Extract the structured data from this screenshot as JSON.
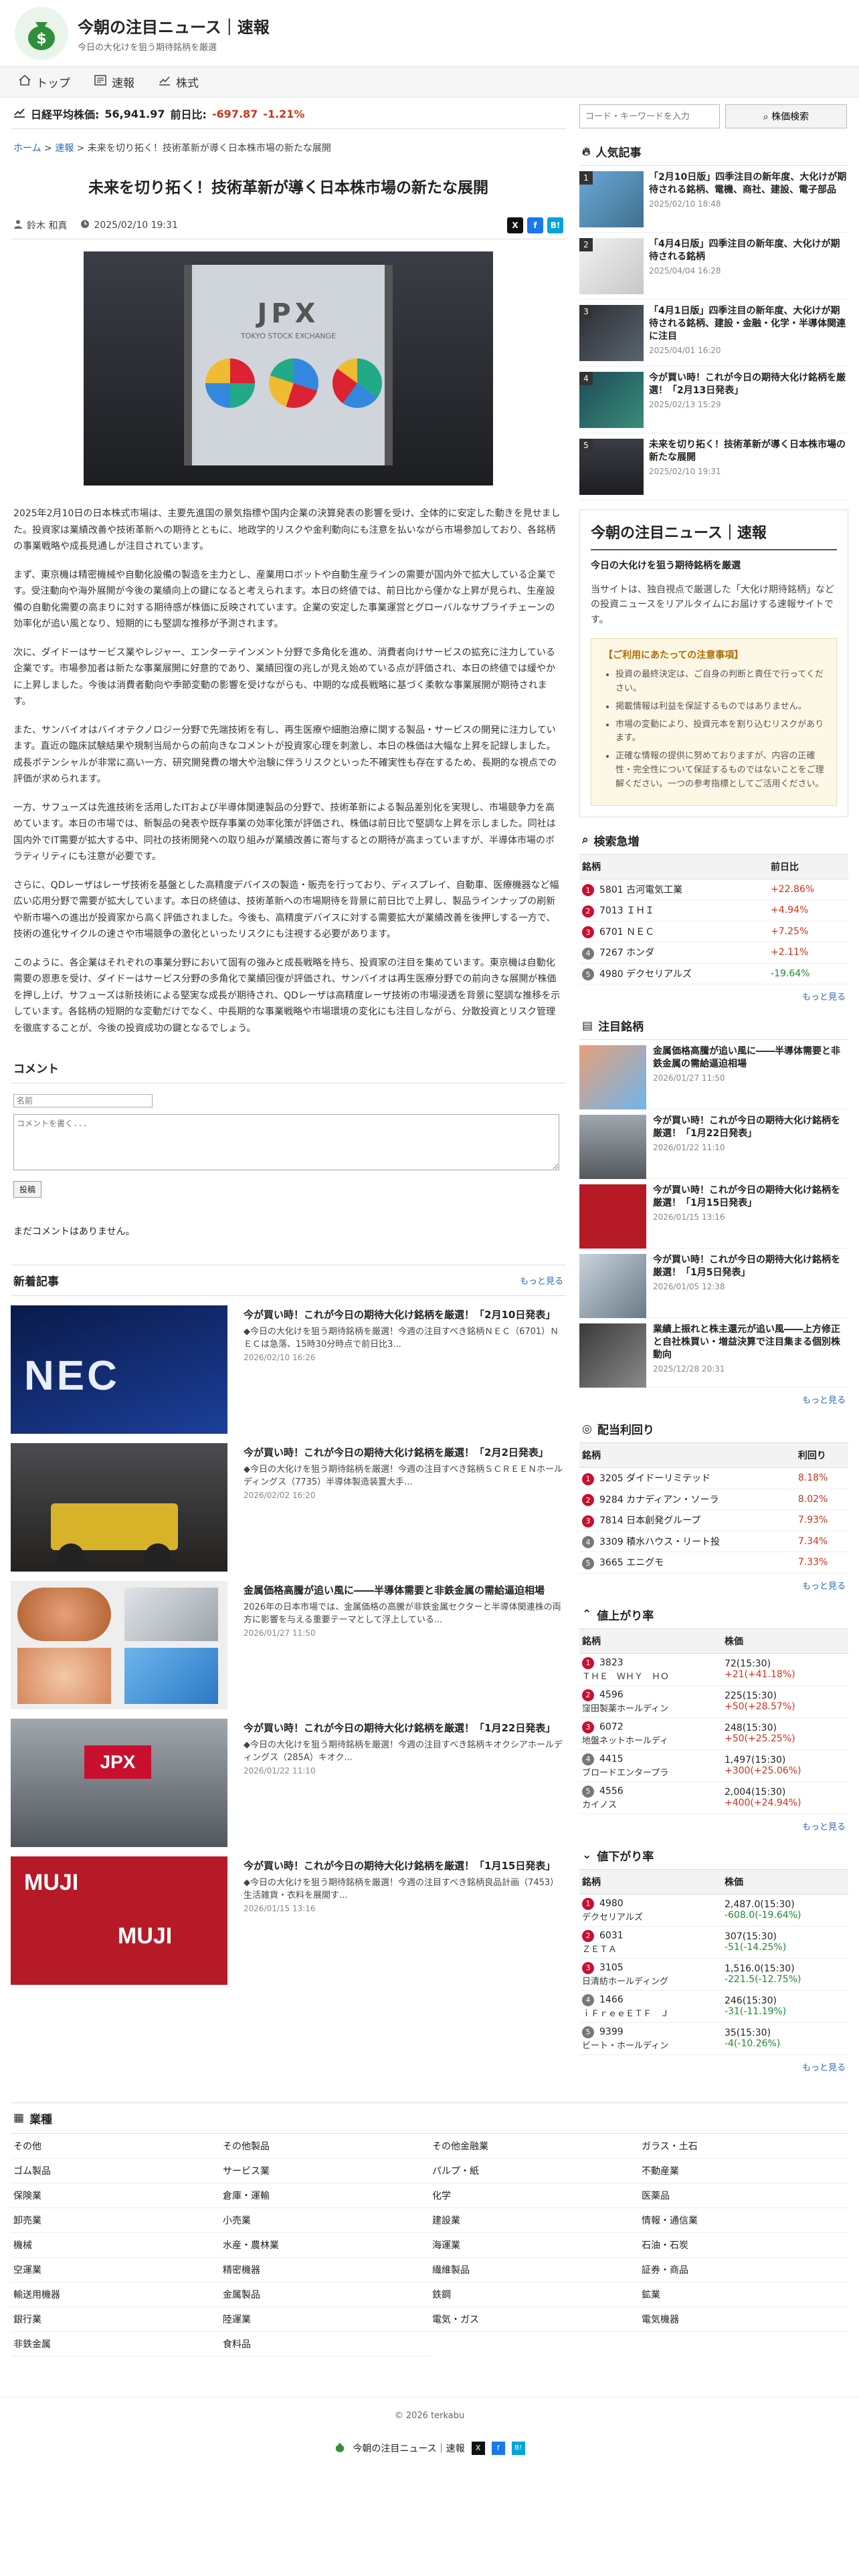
{
  "site": {
    "title": "今朝の注目ニュース｜速報",
    "subtitle": "今日の大化けを狙う期待銘柄を厳選"
  },
  "nav": [
    {
      "label": "トップ"
    },
    {
      "label": "速報"
    },
    {
      "label": "株式"
    }
  ],
  "ticker": {
    "label": "日経平均株価:",
    "value": "56,941.97",
    "change_label": "前日比:",
    "change": "-697.87",
    "pct": "-1.21%"
  },
  "breadcrumb": {
    "home": "ホーム",
    "sep": ">",
    "cat": "速報",
    "current": "未来を切り拓く！技術革新が導く日本株市場の新たな展開"
  },
  "article": {
    "title": "未来を切り拓く！技術革新が導く日本株市場の新たな展開",
    "author": "鈴木 和真",
    "date": "2025/02/10 19:31",
    "hero_text": "JPX",
    "hero_sub": "TOKYO STOCK EXCHANGE",
    "paragraphs": [
      "2025年2月10日の日本株式市場は、主要先進国の景気指標や国内企業の決算発表の影響を受け、全体的に安定した動きを見せました。投資家は業績改善や技術革新への期待とともに、地政学的リスクや金利動向にも注意を払いながら市場参加しており、各銘柄の事業戦略や成長見通しが注目されています。",
      "まず、東京機は精密機械や自動化設備の製造を主力とし、産業用ロボットや自動生産ラインの需要が国内外で拡大している企業です。受注動向や海外展開が今後の業績向上の鍵になると考えられます。本日の終値では、前日比から僅かな上昇が見られ、生産設備の自動化需要の高まりに対する期待感が株価に反映されています。企業の安定した事業運営とグローバルなサプライチェーンの効率化が追い風となり、短期的にも堅調な推移が予測されます。",
      "次に、ダイドーはサービス業やレジャー、エンターテインメント分野で多角化を進め、消費者向けサービスの拡充に注力している企業です。市場参加者は新たな事業展開に好意的であり、業績回復の兆しが見え始めている点が評価され、本日の終値では緩やかに上昇しました。今後は消費者動向や季節変動の影響を受けながらも、中期的な成長戦略に基づく柔軟な事業展開が期待されます。",
      "また、サンバイオはバイオテクノロジー分野で先端技術を有し、再生医療や細胞治療に関する製品・サービスの開発に注力しています。直近の臨床試験結果や規制当局からの前向きなコメントが投資家心理を刺激し、本日の株価は大幅な上昇を記録しました。成長ポテンシャルが非常に高い一方、研究開発費の増大や治験に伴うリスクといった不確実性も存在するため、長期的な視点での評価が求められます。",
      "一方、サフューズは先進技術を活用したITおよび半導体関連製品の分野で、技術革新による製品差別化を実現し、市場競争力を高めています。本日の市場では、新製品の発表や既存事業の効率化策が評価され、株価は前日比で堅調な上昇を示しました。同社は国内外でIT需要が拡大する中、同社の技術開発への取り組みが業績改善に寄与するとの期待が高まっていますが、半導体市場のボラティリティにも注意が必要です。",
      "さらに、QDレーザはレーザ技術を基盤とした高精度デバイスの製造・販売を行っており、ディスプレイ、自動車、医療機器など幅広い応用分野で需要が拡大しています。本日の終値は、技術革新への市場期待を背景に前日比で上昇し、製品ラインナップの刷新や新市場への進出が投資家から高く評価されました。今後も、高精度デバイスに対する需要拡大が業績改善を後押しする一方で、技術の進化サイクルの速さや市場競争の激化といったリスクにも注視する必要があります。",
      "このように、各企業はそれぞれの事業分野において固有の強みと成長戦略を持ち、投資家の注目を集めています。東京機は自動化需要の恩恵を受け、ダイドーはサービス分野の多角化で業績回復が評価され、サンバイオは再生医療分野での前向きな展開が株価を押し上げ、サフューズは新技術による堅実な成長が期待され、QDレーザは高精度レーザ技術の市場浸透を背景に堅調な推移を示しています。各銘柄の短期的な変動だけでなく、中長期的な事業戦略や市場環境の変化にも注目しながら、分散投資とリスク管理を徹底することが、今後の投資成功の鍵となるでしょう。"
    ]
  },
  "comments": {
    "title": "コメント",
    "name_placeholder": "名前",
    "body_placeholder": "コメントを書く...",
    "submit": "投稿",
    "empty": "まだコメントはありません。"
  },
  "new_articles": {
    "title": "新着記事",
    "more": "もっと見る",
    "items": [
      {
        "title": "今が買い時！これが今日の期待大化け銘柄を厳選！「2月10日発表」",
        "desc": "◆今日の大化けを狙う期待銘柄を厳選！今週の注目すべき銘柄ＮＥＣ（6701）ＮＥＣは急落、15時30分時点で前日比3...",
        "date": "2026/02/10 16:26",
        "thumb": "NEC"
      },
      {
        "title": "今が買い時！これが今日の期待大化け銘柄を厳選！「2月2日発表」",
        "desc": "◆今日の大化けを狙う期待銘柄を厳選！今週の注目すべき銘柄ＳＣＲＥＥＮホールディングス（7735）半導体製造装置大手...",
        "date": "2026/02/02 16:20",
        "thumb": ""
      },
      {
        "title": "金属価格高騰が追い風に――半導体需要と非鉄金属の需給逼迫相場",
        "desc": "2026年の日本市場では、金属価格の高騰が非鉄金属セクターと半導体関連株の両方に影響を与える重要テーマとして浮上している...",
        "date": "2026/01/27 11:50",
        "thumb": ""
      },
      {
        "title": "今が買い時！これが今日の期待大化け銘柄を厳選！「1月22日発表」",
        "desc": "◆今日の大化けを狙う期待銘柄を厳選！今週の注目すべき銘柄キオクシアホールディングス（285A）キオク...",
        "date": "2026/01/22 11:10",
        "thumb": "JPX"
      },
      {
        "title": "今が買い時！これが今日の期待大化け銘柄を厳選！「1月15日発表」",
        "desc": "◆今日の大化けを狙う期待銘柄を厳選！今週の注目すべき銘柄良品計画（7453）生活雑貨・衣料を展開す...",
        "date": "2026/01/15 13:16",
        "thumb": "MUJI"
      }
    ]
  },
  "search": {
    "placeholder": "コード・キーワードを入力",
    "button": "株価検索"
  },
  "popular": {
    "title": "人気記事",
    "items": [
      {
        "n": "1",
        "title": "「2月10日版」四季注目の新年度、大化けが期待される銘柄、電機、商社、建設、電子部品",
        "date": "2025/02/10 18:48"
      },
      {
        "n": "2",
        "title": "「4月4日版」四季注目の新年度、大化けが期待される銘柄",
        "date": "2025/04/04 16:28"
      },
      {
        "n": "3",
        "title": "「4月1日版」四季注目の新年度、大化けが期待される銘柄、建設・金融・化学・半導体関連に注目",
        "date": "2025/04/01 16:20"
      },
      {
        "n": "4",
        "title": "今が買い時！これが今日の期待大化け銘柄を厳選！「2月13日発表」",
        "date": "2025/02/13 15:29"
      },
      {
        "n": "5",
        "title": "未来を切り拓く！技術革新が導く日本株市場の新たな展開",
        "date": "2025/02/10 19:31"
      }
    ]
  },
  "about": {
    "title": "今朝の注目ニュース｜速報",
    "sub": "今日の大化けを狙う期待銘柄を厳選",
    "desc": "当サイトは、独自視点で厳選した「大化け期待銘柄」などの投資ニュースをリアルタイムにお届けする速報サイトです。",
    "notice_title": "【ご利用にあたっての注意事項】",
    "notices": [
      "投資の最終決定は、ご自身の判断と責任で行ってください。",
      "掲載情報は利益を保証するものではありません。",
      "市場の変動により、投資元本を割り込むリスクがあります。",
      "正確な情報の提供に努めておりますが、内容の正確性・完全性について保証するものではないことをご理解ください。一つの参考指標としてご活用ください。"
    ]
  },
  "surge": {
    "title": "検索急増",
    "col1": "銘柄",
    "col2": "前日比",
    "rows": [
      {
        "n": "1",
        "code": "5801",
        "name": "古河電気工業",
        "chg": "+22.86%",
        "dir": "up"
      },
      {
        "n": "2",
        "code": "7013",
        "name": "ＩＨＩ",
        "chg": "+4.94%",
        "dir": "up"
      },
      {
        "n": "3",
        "code": "6701",
        "name": "ＮＥＣ",
        "chg": "+7.25%",
        "dir": "up"
      },
      {
        "n": "4",
        "code": "7267",
        "name": "ホンダ",
        "chg": "+2.11%",
        "dir": "up"
      },
      {
        "n": "5",
        "code": "4980",
        "name": "デクセリアルズ",
        "chg": "-19.64%",
        "dir": "down"
      }
    ],
    "more": "もっと見る"
  },
  "attention": {
    "title": "注目銘柄",
    "items": [
      {
        "title": "金属価格高騰が追い風に――半導体需要と非鉄金属の需給逼迫相場",
        "date": "2026/01/27 11:50"
      },
      {
        "title": "今が買い時！これが今日の期待大化け銘柄を厳選！「1月22日発表」",
        "date": "2026/01/22 11:10"
      },
      {
        "title": "今が買い時！これが今日の期待大化け銘柄を厳選！「1月15日発表」",
        "date": "2026/01/15 13:16"
      },
      {
        "title": "今が買い時！これが今日の期待大化け銘柄を厳選！「1月5日発表」",
        "date": "2026/01/05 12:38"
      },
      {
        "title": "業績上振れと株主還元が追い風――上方修正と自社株買い・増益決算で注目集まる個別株動向",
        "date": "2025/12/28 20:31"
      }
    ],
    "more": "もっと見る"
  },
  "dividend": {
    "title": "配当利回り",
    "col1": "銘柄",
    "col2": "利回り",
    "rows": [
      {
        "n": "1",
        "code": "3205",
        "name": "ダイドーリミテッド",
        "v": "8.18%"
      },
      {
        "n": "2",
        "code": "9284",
        "name": "カナディアン・ソーラ",
        "v": "8.02%"
      },
      {
        "n": "3",
        "code": "7814",
        "name": "日本創発グループ",
        "v": "7.93%"
      },
      {
        "n": "4",
        "code": "3309",
        "name": "積水ハウス・リート投",
        "v": "7.34%"
      },
      {
        "n": "5",
        "code": "3665",
        "name": "エニグモ",
        "v": "7.33%"
      }
    ],
    "more": "もっと見る"
  },
  "gainers": {
    "title": "値上がり率",
    "col1": "銘柄",
    "col2": "株価",
    "rows": [
      {
        "n": "1",
        "code": "3823",
        "name": "ＴＨＥ　ＷＨＹ　ＨＯ",
        "price": "72(15:30)",
        "chg": "+21(+41.18%)"
      },
      {
        "n": "2",
        "code": "4596",
        "name": "窪田製薬ホールディン",
        "price": "225(15:30)",
        "chg": "+50(+28.57%)"
      },
      {
        "n": "3",
        "code": "6072",
        "name": "地盤ネットホールディ",
        "price": "248(15:30)",
        "chg": "+50(+25.25%)"
      },
      {
        "n": "4",
        "code": "4415",
        "name": "ブロードエンタープラ",
        "price": "1,497(15:30)",
        "chg": "+300(+25.06%)"
      },
      {
        "n": "5",
        "code": "4556",
        "name": "カイノス",
        "price": "2,004(15:30)",
        "chg": "+400(+24.94%)"
      }
    ],
    "more": "もっと見る"
  },
  "losers": {
    "title": "値下がり率",
    "col1": "銘柄",
    "col2": "株価",
    "rows": [
      {
        "n": "1",
        "code": "4980",
        "name": "デクセリアルズ",
        "price": "2,487.0(15:30)",
        "chg": "-608.0(-19.64%)"
      },
      {
        "n": "2",
        "code": "6031",
        "name": "ＺＥＴＡ",
        "price": "307(15:30)",
        "chg": "-51(-14.25%)"
      },
      {
        "n": "3",
        "code": "3105",
        "name": "日清紡ホールディング",
        "price": "1,516.0(15:30)",
        "chg": "-221.5(-12.75%)"
      },
      {
        "n": "4",
        "code": "1466",
        "name": "ｉＦｒｅｅＥＴＦ　Ｊ",
        "price": "246(15:30)",
        "chg": "-31(-11.19%)"
      },
      {
        "n": "5",
        "code": "9399",
        "name": "ビート・ホールディン",
        "price": "35(15:30)",
        "chg": "-4(-10.26%)"
      }
    ],
    "more": "もっと見る"
  },
  "industry": {
    "title": "業種",
    "items": [
      "その他",
      "その他製品",
      "その他金融業",
      "ガラス・土石",
      "ゴム製品",
      "サービス業",
      "パルプ・紙",
      "不動産業",
      "保険業",
      "倉庫・運輸",
      "化学",
      "医薬品",
      "卸売業",
      "小売業",
      "建設業",
      "情報・通信業",
      "機械",
      "水産・農林業",
      "海運業",
      "石油・石炭",
      "空運業",
      "精密機器",
      "繊維製品",
      "証券・商品",
      "輸送用機器",
      "金属製品",
      "鉄鋼",
      "鉱業",
      "銀行業",
      "陸運業",
      "電気・ガス",
      "電気機器",
      "非鉄金属",
      "食料品"
    ]
  },
  "footer": {
    "copy": "© 2026 terkabu",
    "brand": "今朝の注目ニュース｜速報"
  }
}
